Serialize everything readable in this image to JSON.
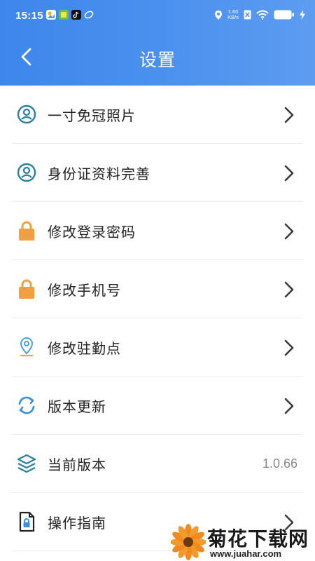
{
  "status_bar": {
    "time": "15:15",
    "speed_value": "1.60",
    "speed_unit": "KB/s",
    "battery": "",
    "app_badges": [
      "photos-app-icon",
      "fruit-app-icon",
      "tiktok-app-icon",
      "swirl-app-icon"
    ]
  },
  "nav": {
    "title": "设置",
    "back_icon": "chevron-left-icon"
  },
  "settings": {
    "items": [
      {
        "label": "一寸免冠照片",
        "icon": "user-circle-icon"
      },
      {
        "label": "身份证资料完善",
        "icon": "user-circle-icon"
      },
      {
        "label": "修改登录密码",
        "icon": "lock-icon"
      },
      {
        "label": "修改手机号",
        "icon": "lock-icon"
      },
      {
        "label": "修改驻勤点",
        "icon": "location-pin-icon"
      },
      {
        "label": "版本更新",
        "icon": "refresh-icon"
      },
      {
        "label": "当前版本",
        "icon": "layers-icon",
        "value": "1.0.66"
      },
      {
        "label": "操作指南",
        "icon": "document-lock-icon"
      }
    ]
  },
  "watermark": {
    "title": "菊花下载网",
    "url": "www.juahar.com"
  },
  "colors": {
    "header_blue": "#4a90ee",
    "icon_teal": "#2a7fa0",
    "lock_orange": "#f0a040",
    "chevron_gray": "#3a3a3a"
  }
}
